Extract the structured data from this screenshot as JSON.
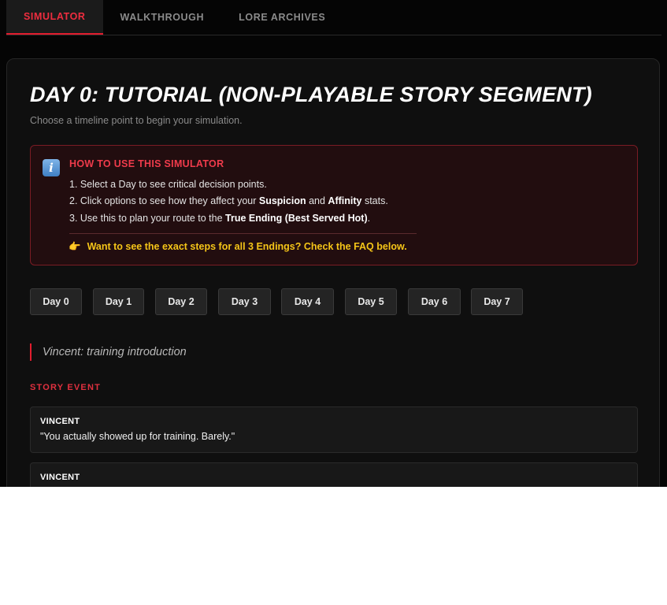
{
  "tabs": [
    {
      "label": "SIMULATOR",
      "active": true
    },
    {
      "label": "WALKTHROUGH",
      "active": false
    },
    {
      "label": "LORE ARCHIVES",
      "active": false
    }
  ],
  "page": {
    "title": "DAY 0: TUTORIAL (NON-PLAYABLE STORY SEGMENT)",
    "subtitle": "Choose a timeline point to begin your simulation."
  },
  "info": {
    "icon": "info-icon",
    "icon_glyph": "i",
    "heading": "HOW TO USE THIS SIMULATOR",
    "step1": "1. Select a Day to see critical decision points.",
    "step2_pre": "2. Click options to see how they affect your ",
    "step2_b1": "Suspicion",
    "step2_mid": " and ",
    "step2_b2": "Affinity",
    "step2_post": " stats.",
    "step3_pre": "3. Use this to plan your route to the ",
    "step3_b": "True Ending (Best Served Hot)",
    "step3_post": ".",
    "faq_icon": "pointing-hand-icon",
    "faq_glyph": "👉",
    "faq_text": "Want to see the exact steps for all 3 Endings? Check the FAQ below."
  },
  "days": [
    "Day 0",
    "Day 1",
    "Day 2",
    "Day 3",
    "Day 4",
    "Day 5",
    "Day 6",
    "Day 7"
  ],
  "quote": "Vincent: training introduction",
  "story_label": "STORY EVENT",
  "dialogue": [
    {
      "speaker": "VINCENT",
      "line": "\"You actually showed up for training. Barely.\""
    },
    {
      "speaker": "VINCENT",
      "line": ""
    }
  ],
  "colors": {
    "accent_red": "#e11d2e",
    "faq_yellow": "#f5c518",
    "background": "#050505",
    "card": "#0f0f0f"
  }
}
